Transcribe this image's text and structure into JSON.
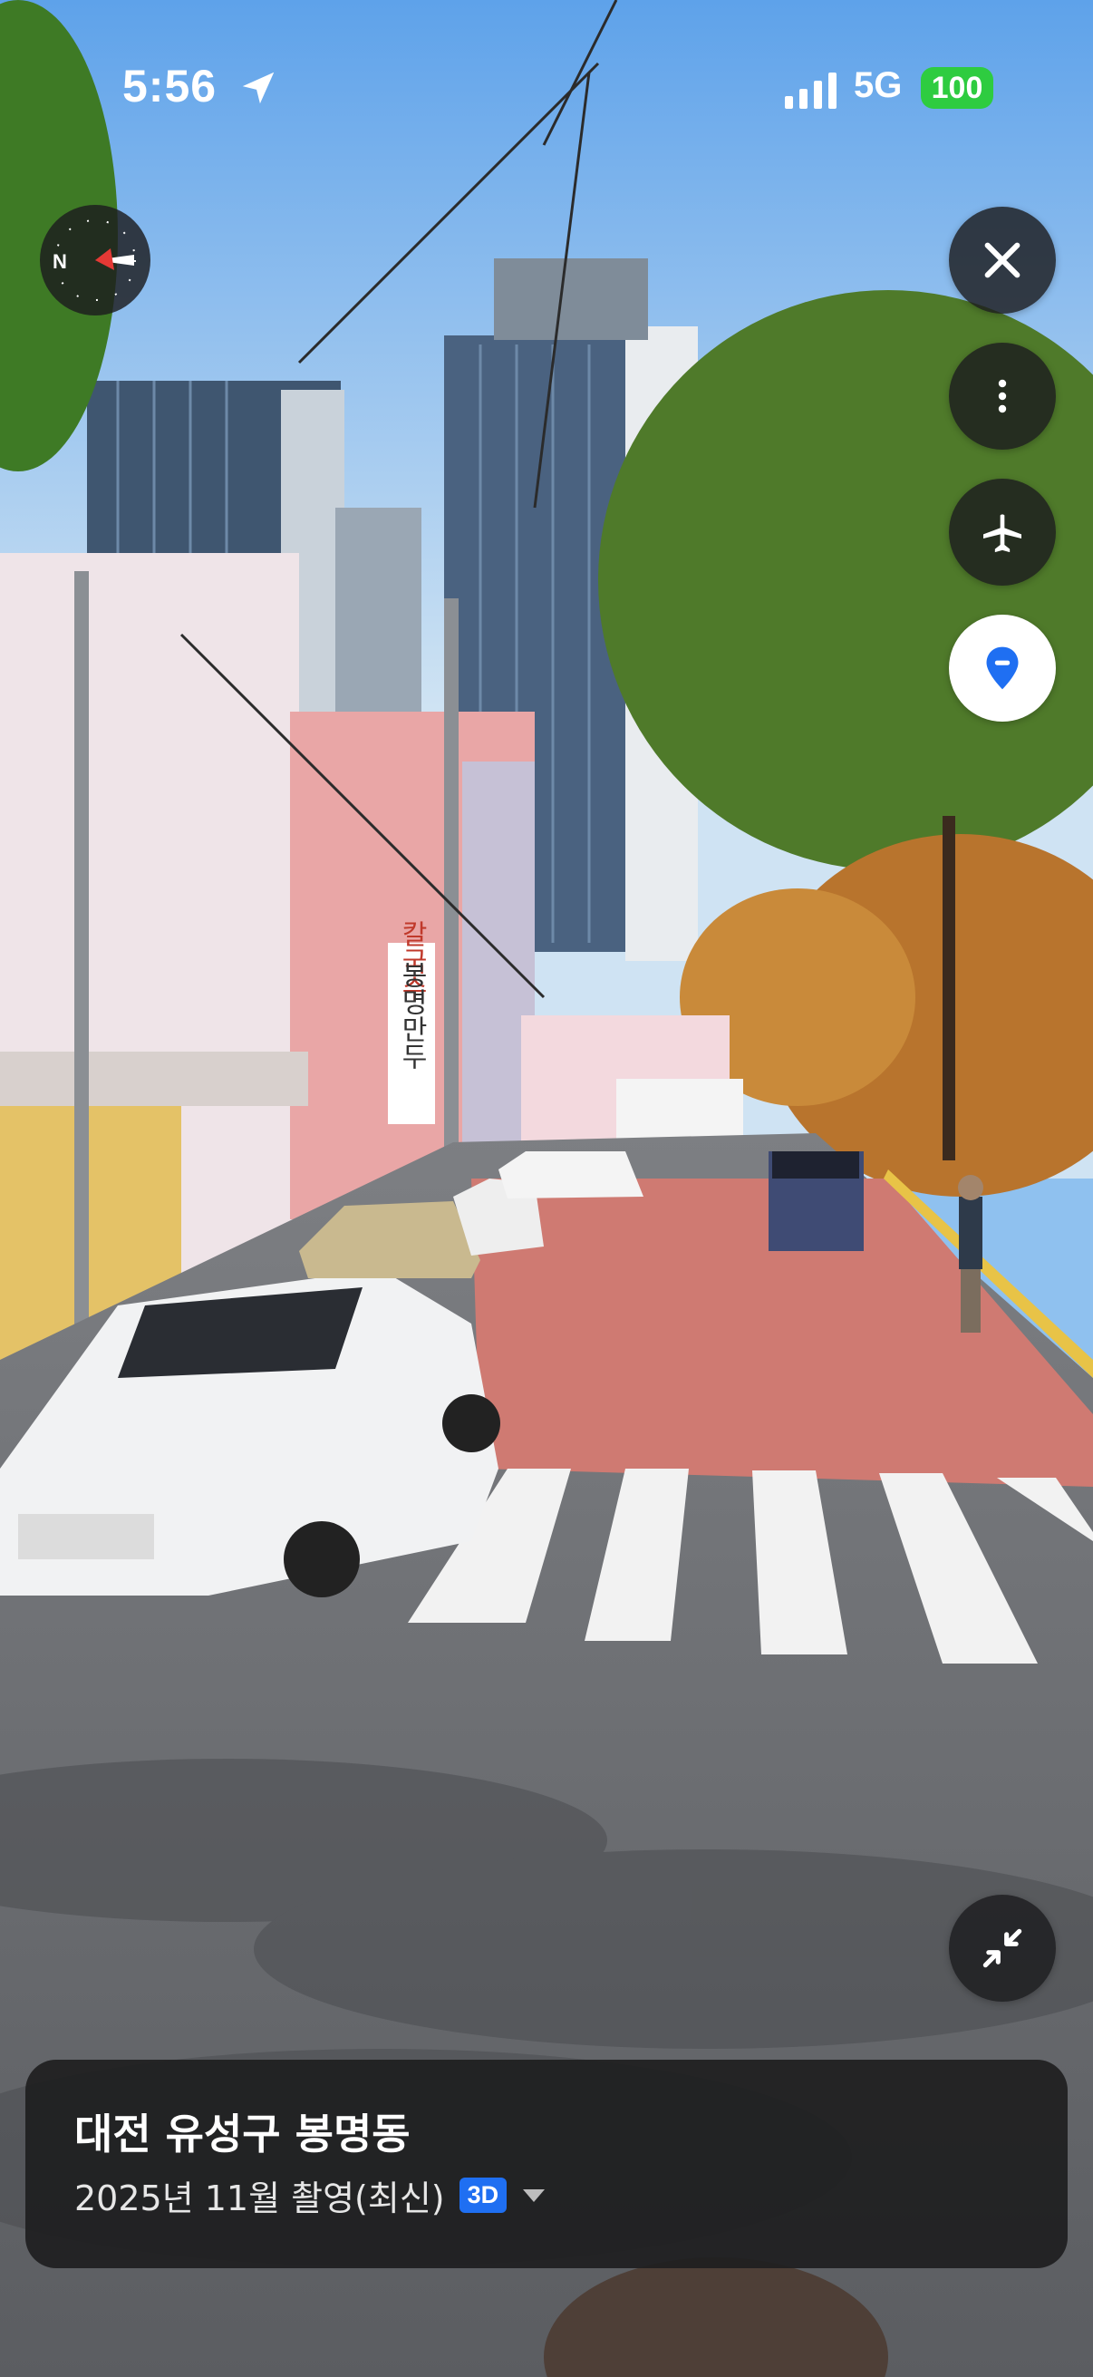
{
  "status_bar": {
    "time": "5:56",
    "network": "5G",
    "battery": "100"
  },
  "controls": {
    "compass_label": "N",
    "icons": [
      "location-arrow-icon",
      "signal-icon",
      "compass-icon",
      "close-icon",
      "more-vertical-icon",
      "airplane-icon",
      "map-pin-icon",
      "collapse-icon"
    ]
  },
  "scene": {
    "signs": [
      "칼국수",
      "봉명만두"
    ]
  },
  "info_card": {
    "title": "대전 유성구 봉명동",
    "captured": "2025년 11월 촬영(최신)",
    "badge": "3D"
  },
  "colors": {
    "accent": "#1f6ff2",
    "battery": "#2ecc40",
    "button_bg": "#1c1c1e"
  }
}
